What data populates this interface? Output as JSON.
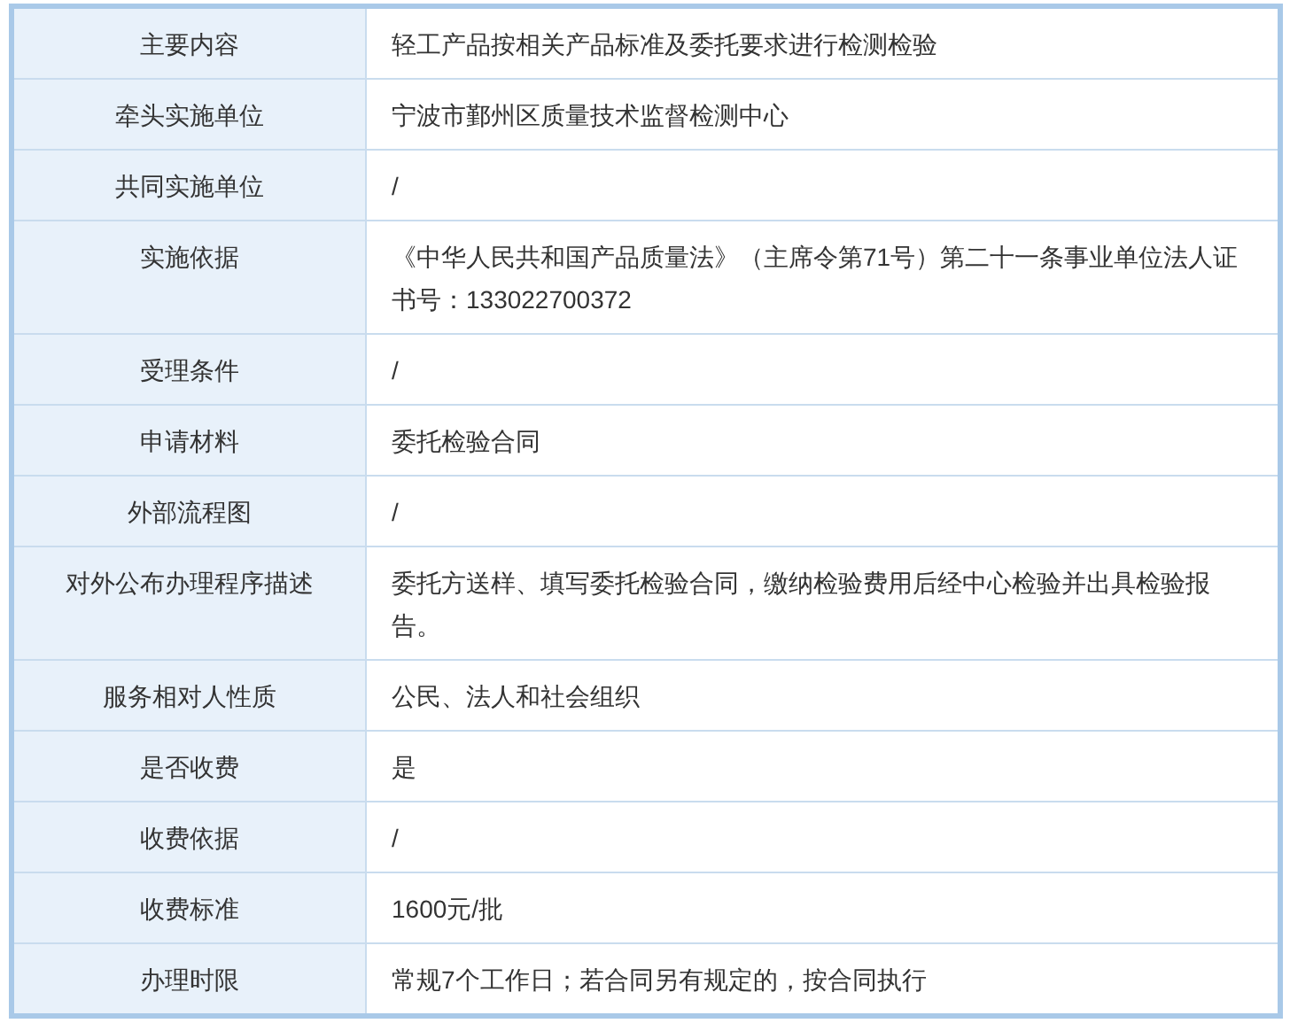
{
  "rows": [
    {
      "label": "主要内容",
      "value": "轻工产品按相关产品标准及委托要求进行检测检验"
    },
    {
      "label": "牵头实施单位",
      "value": "宁波市鄞州区质量技术监督检测中心"
    },
    {
      "label": "共同实施单位",
      "value": "/"
    },
    {
      "label": "实施依据",
      "value": "《中华人民共和国产品质量法》（主席令第71号）第二十一条事业单位法人证书号：133022700372"
    },
    {
      "label": "受理条件",
      "value": "/"
    },
    {
      "label": "申请材料",
      "value": "委托检验合同"
    },
    {
      "label": "外部流程图",
      "value": "/"
    },
    {
      "label": "对外公布办理程序描述",
      "value": "委托方送样、填写委托检验合同，缴纳检验费用后经中心检验并出具检验报告。"
    },
    {
      "label": "服务相对人性质",
      "value": "公民、法人和社会组织"
    },
    {
      "label": "是否收费",
      "value": "是"
    },
    {
      "label": "收费依据",
      "value": "/"
    },
    {
      "label": "收费标准",
      "value": "1600元/批"
    },
    {
      "label": "办理时限",
      "value": "常规7个工作日；若合同另有规定的，按合同执行"
    }
  ]
}
